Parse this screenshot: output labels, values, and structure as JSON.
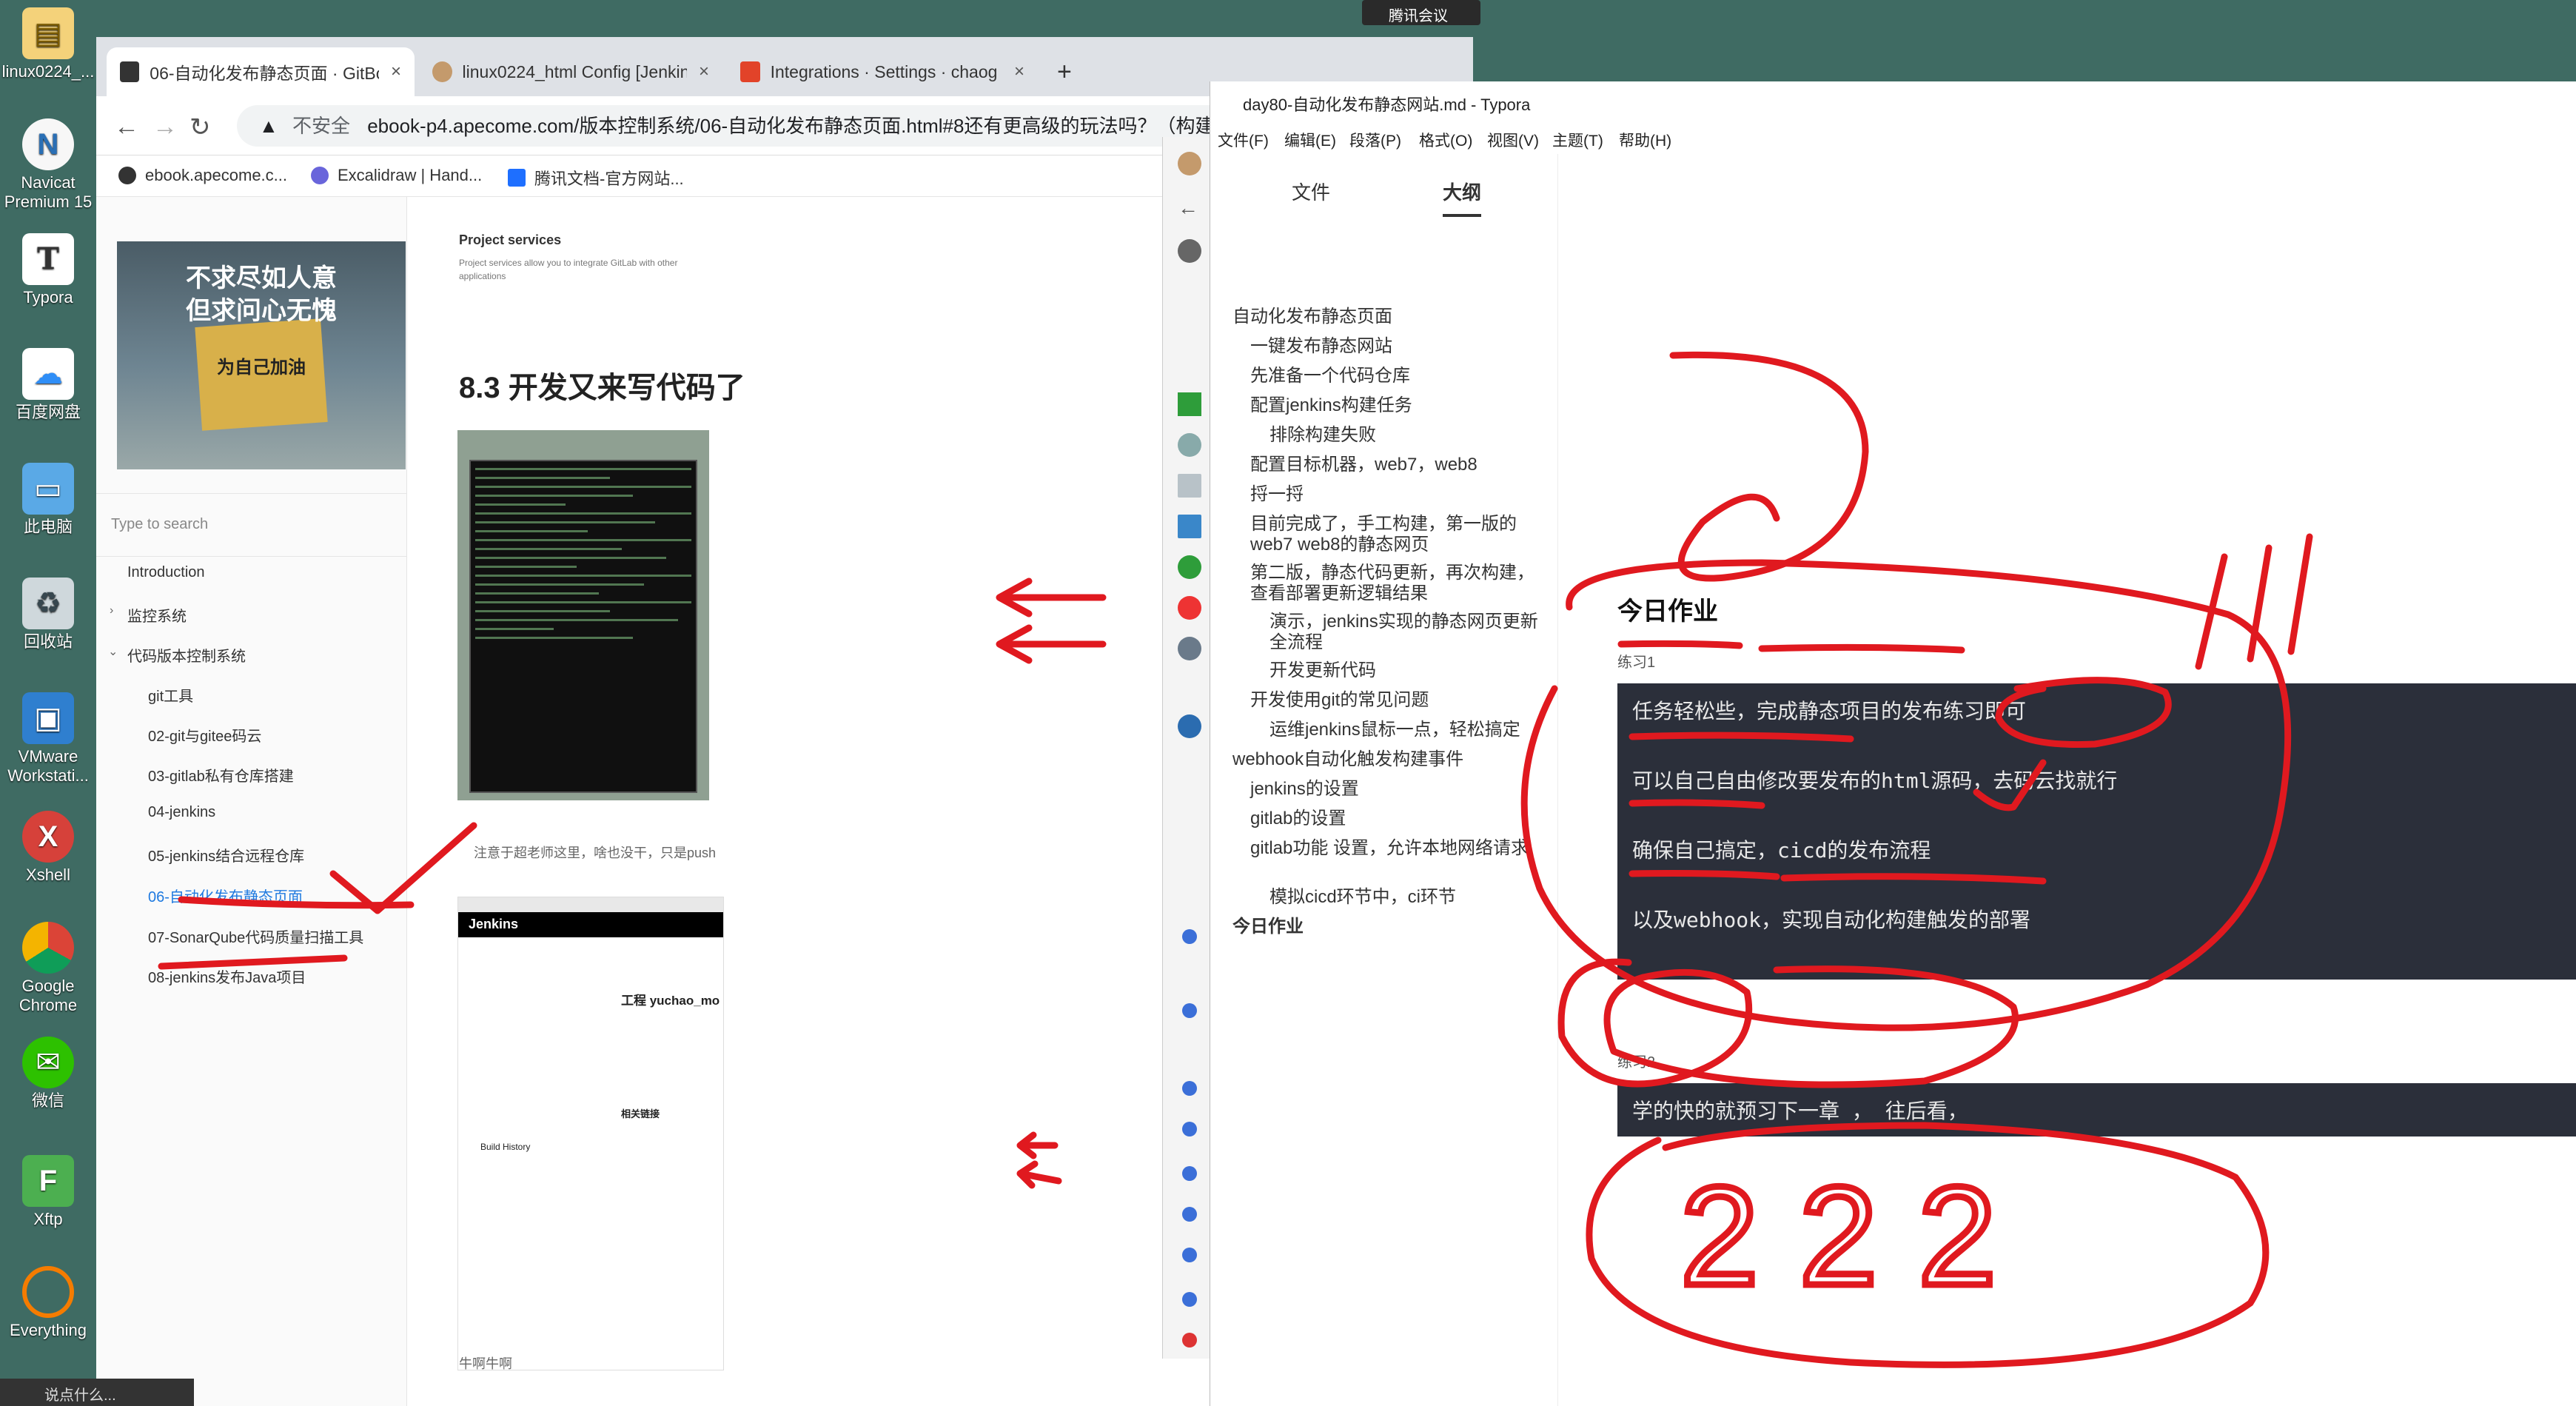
{
  "desktop": {
    "icons": [
      {
        "label": "linux0224_..."
      },
      {
        "label": "Navicat Premium 15"
      },
      {
        "label": "Typora"
      },
      {
        "label": "百度网盘"
      },
      {
        "label": "此电脑"
      },
      {
        "label": "回收站"
      },
      {
        "label": "VMware Workstati..."
      },
      {
        "label": "Xshell"
      },
      {
        "label": "Google Chrome"
      },
      {
        "label": "微信"
      },
      {
        "label": "Xftp"
      },
      {
        "label": "Everything"
      }
    ],
    "meeting_label": "腾讯会议",
    "chat_placeholder": "说点什么..."
  },
  "chrome": {
    "tabs": [
      {
        "title": "06-自动化发布静态页面 · GitBo",
        "close": "×"
      },
      {
        "title": "linux0224_html Config [Jenkin",
        "close": "×"
      },
      {
        "title": "Integrations · Settings · chaog",
        "close": "×"
      }
    ],
    "new_tab": "+",
    "insecure": "不安全",
    "url": "ebook-p4.apecome.com/版本控制系统/06-自动化发布静态页面.html#8还有更高级的玩法吗？（构建触发",
    "bookmarks": [
      "ebook.apecome.c...",
      "Excalidraw | Hand...",
      "腾讯文档-官方网站..."
    ]
  },
  "gitbook": {
    "poster_lines": [
      "不求尽如人意",
      "但求问心无愧",
      "为自己加油"
    ],
    "search_placeholder": "Type to search",
    "nav": [
      "Introduction",
      "监控系统",
      "代码版本控制系统",
      "git工具",
      "02-git与gitee码云",
      "03-gitlab私有仓库搭建",
      "04-jenkins",
      "05-jenkins结合远程仓库",
      "06-自动化发布静态页面",
      "07-SonarQube代码质量扫描工具",
      "08-jenkins发布Java项目"
    ],
    "content": {
      "project_services": "Project services",
      "project_services_desc": "Project services allow you to integrate GitLab with other applications",
      "heading": "8.3 开发又来写代码了",
      "note": "注意于超老师这里，啥也没干，只是push",
      "jenkins_brand": "Jenkins",
      "jenkins_project": "工程 yuchao_mo",
      "build_history": "Build History",
      "related_links": "相关链接",
      "footer_text": "牛啊牛啊"
    }
  },
  "typora": {
    "title": "day80-自动化发布静态网站.md - Typora",
    "menu": [
      "文件(F)",
      "编辑(E)",
      "段落(P)",
      "格式(O)",
      "视图(V)",
      "主题(T)",
      "帮助(H)"
    ],
    "side_tabs": [
      "文件",
      "大纲"
    ],
    "outline": [
      "自动化发布静态页面",
      "一键发布静态网站",
      "先准备一个代码仓库",
      "配置jenkins构建任务",
      "排除构建失败",
      "配置目标机器，web7，web8",
      "捋一捋",
      "目前完成了，手工构建，第一版的web7 web8的静态网页",
      "第二版，静态代码更新，再次构建，查看部署更新逻辑结果",
      "演示，jenkins实现的静态网页更新全流程",
      "开发更新代码",
      "开发使用git的常见问题",
      "运维jenkins鼠标一点，轻松搞定",
      "webhook自动化触发构建事件",
      "jenkins的设置",
      "gitlab的设置",
      "gitlab功能 设置，允许本地网络请求",
      "模拟cicd环节中，ci环节",
      "今日作业"
    ],
    "doc": {
      "heading": "今日作业",
      "ex1_label": "练习1",
      "ex1_lines": [
        "任务轻松些，完成静态项目的发布练习即可",
        "可以自己自由修改要发布的html源码，去码云找就行",
        "确保自己搞定，cicd的发布流程",
        "以及webhook，实现自动化构建触发的部署"
      ],
      "ex2_label": "练习2",
      "ex2_lines": [
        "学的快的就预习下一章 ， 往后看，"
      ]
    }
  },
  "annotations": {
    "handwritten_222": "222"
  },
  "colors": {
    "ink": "#e0191f",
    "link_active": "#1f7ae0",
    "code_bg": "#2b2f3a"
  }
}
